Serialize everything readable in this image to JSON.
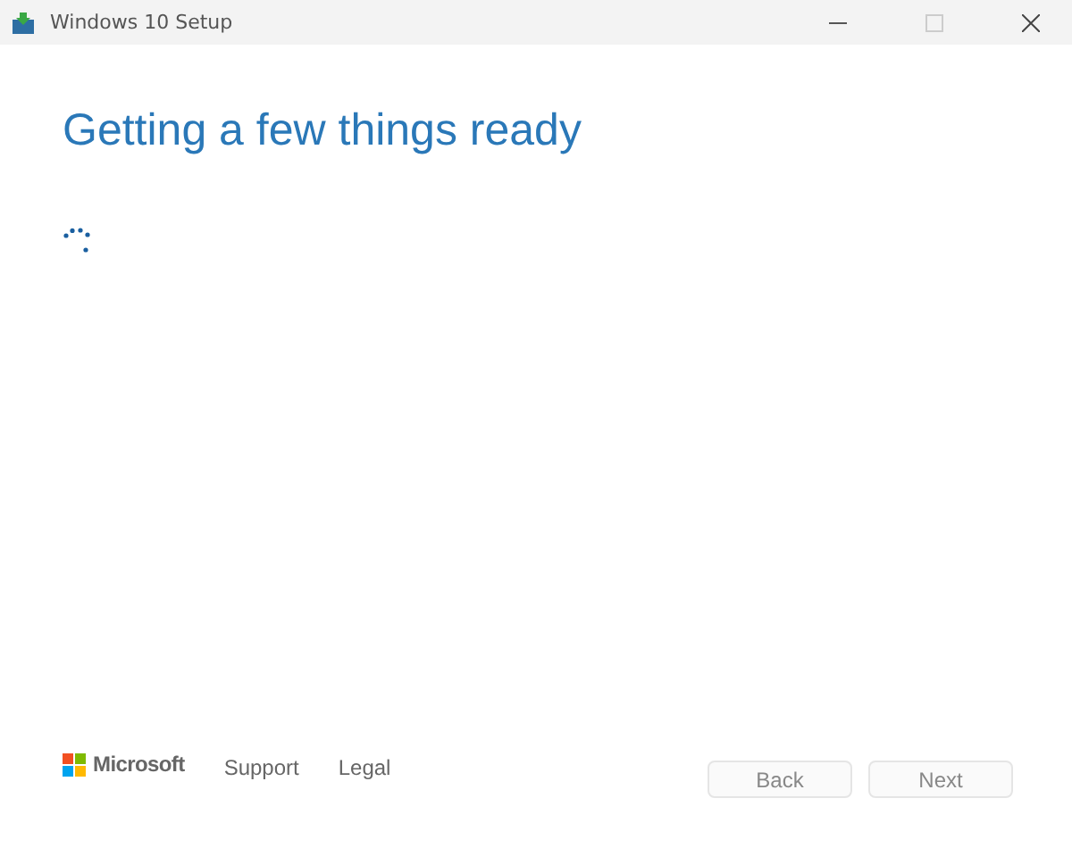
{
  "window": {
    "title": "Windows 10 Setup",
    "maximize_disabled": true
  },
  "heading": "Getting a few things ready",
  "footer": {
    "logo": "Microsoft",
    "links": [
      "Support",
      "Legal"
    ],
    "buttons": [
      {
        "label": "Back",
        "disabled": true
      },
      {
        "label": "Next",
        "disabled": true
      }
    ]
  }
}
